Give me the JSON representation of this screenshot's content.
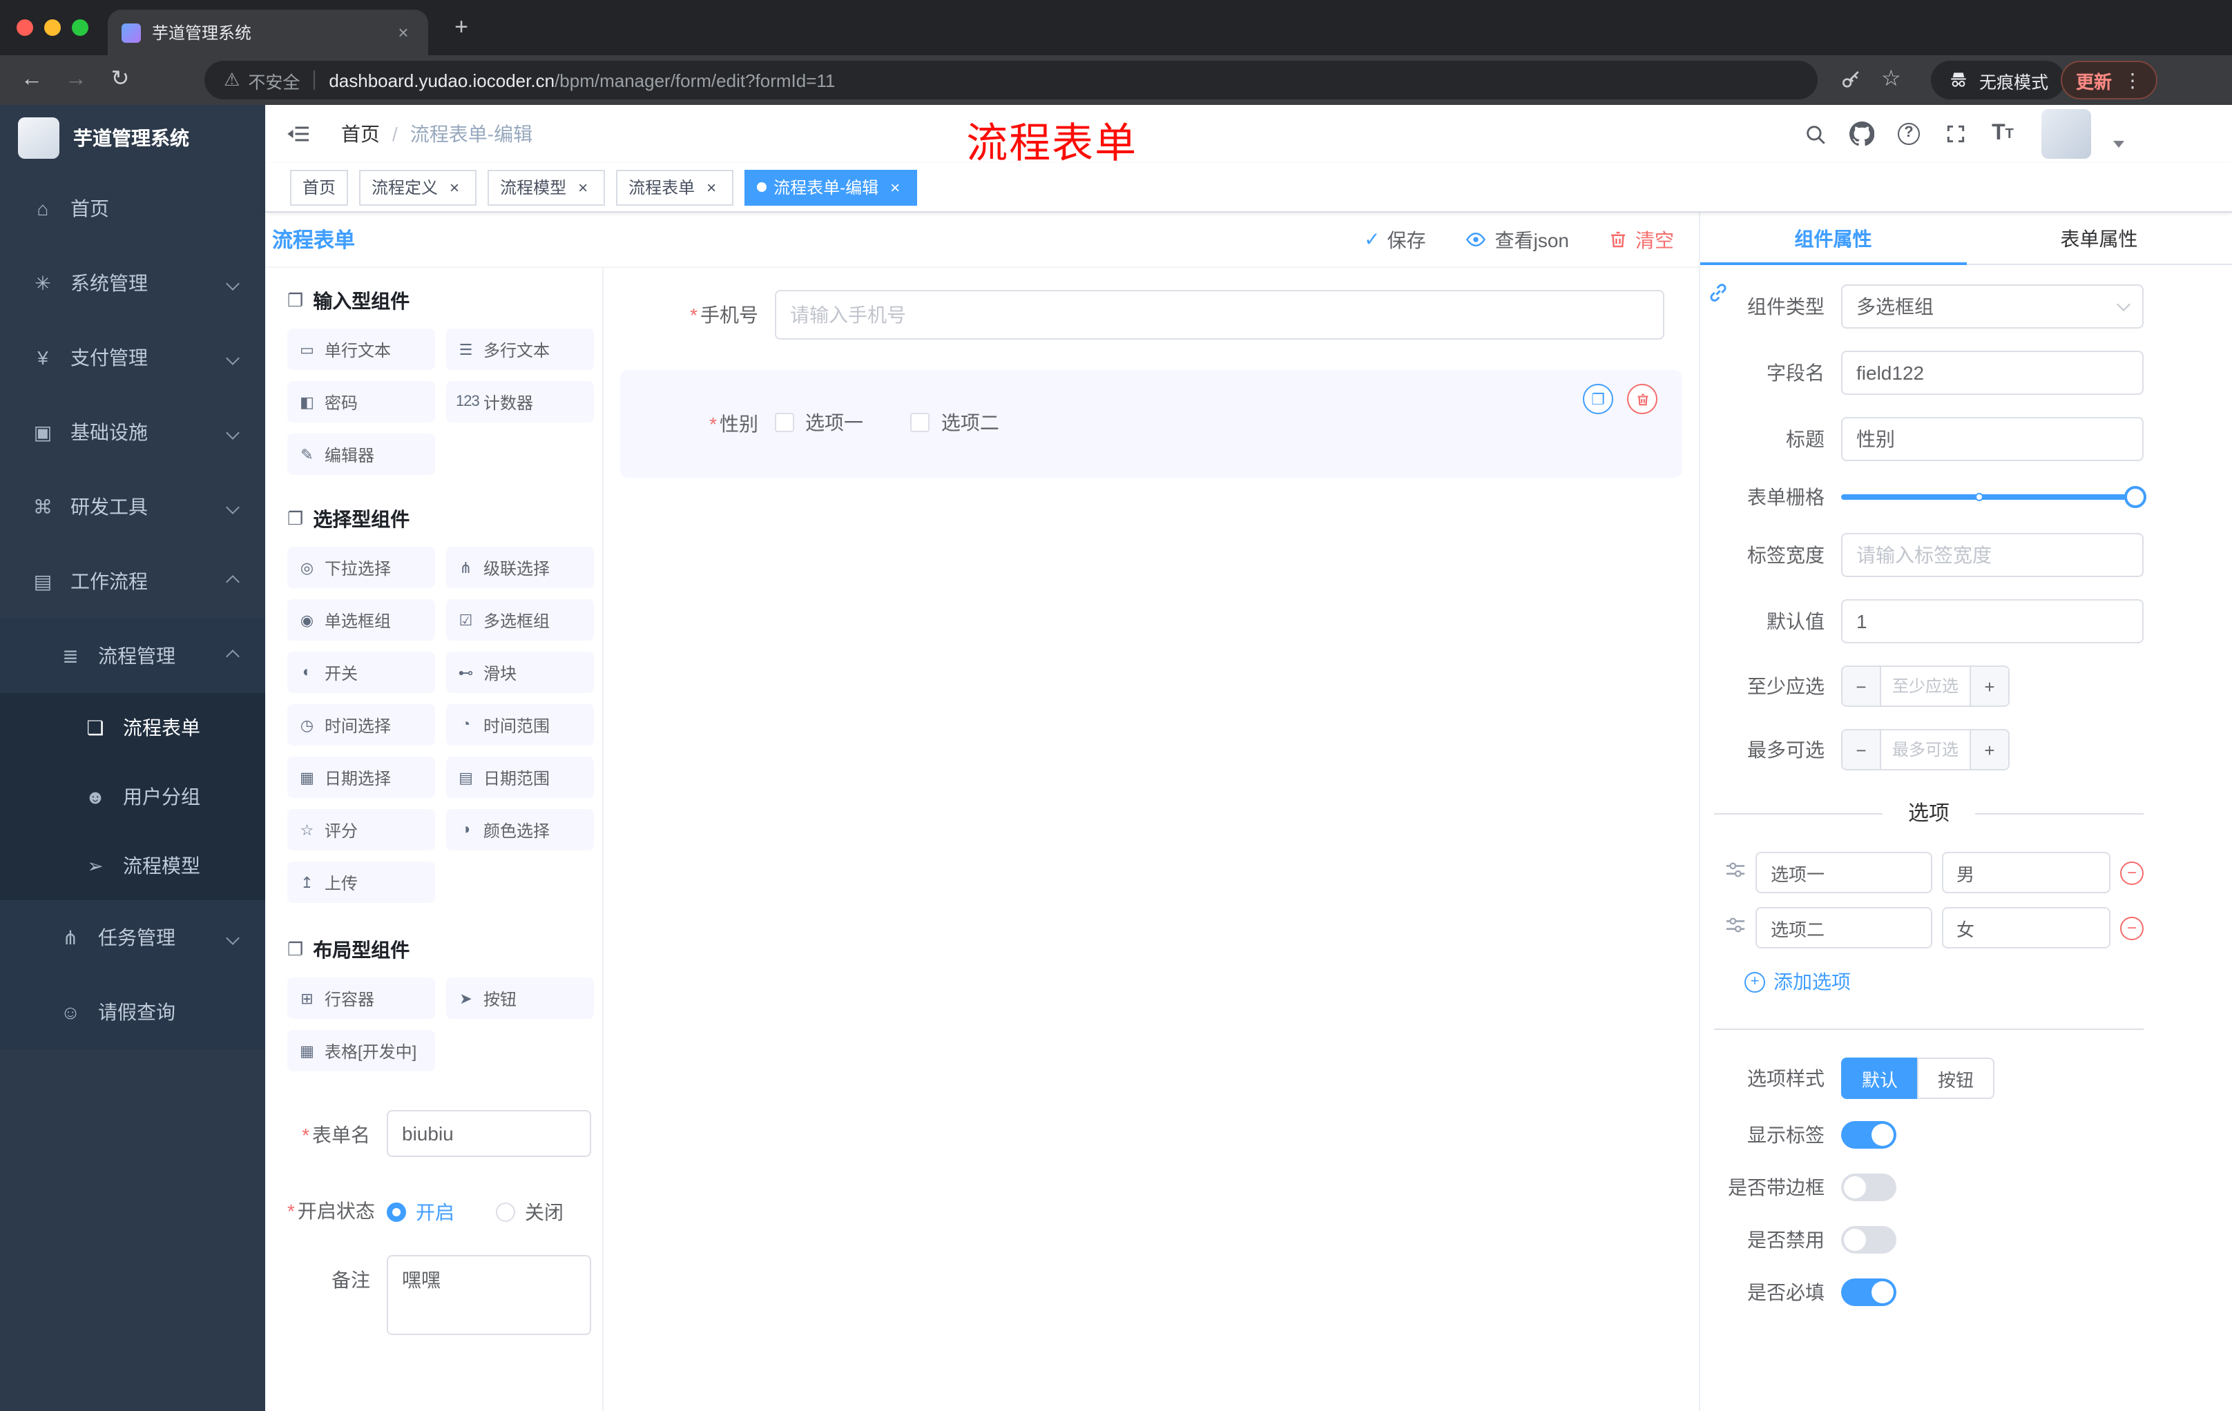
{
  "browser": {
    "tab_title": "芋道管理系统",
    "security_label": "不安全",
    "url_host": "dashboard.yudao.iocoder.cn",
    "url_path": "/bpm/manager/form/edit?formId=11",
    "incognito_label": "无痕模式",
    "update_label": "更新"
  },
  "icons": {
    "back": "←",
    "forward": "→",
    "reload": "↻",
    "warning": "⚠",
    "star": "☆",
    "new_tab": "+",
    "close": "×",
    "more": "⋮",
    "copy": "❐",
    "group": "❐",
    "minus": "−",
    "plus": "+",
    "check": "✓"
  },
  "sidebar": {
    "app_title": "芋道管理系统",
    "items": [
      {
        "icon": "⌂",
        "label": "首页"
      },
      {
        "icon": "✳",
        "label": "系统管理"
      },
      {
        "icon": "¥",
        "label": "支付管理"
      },
      {
        "icon": "▣",
        "label": "基础设施"
      },
      {
        "icon": "⌘",
        "label": "研发工具"
      },
      {
        "icon": "▤",
        "label": "工作流程"
      },
      {
        "icon": "≣",
        "label": "流程管理"
      },
      {
        "icon": "❏",
        "label": "流程表单"
      },
      {
        "icon": "☻",
        "label": "用户分组"
      },
      {
        "icon": "➢",
        "label": "流程模型"
      },
      {
        "icon": "⋔",
        "label": "任务管理"
      },
      {
        "icon": "☺",
        "label": "请假查询"
      }
    ]
  },
  "header": {
    "breadcrumb_home": "首页",
    "breadcrumb_sep": "/",
    "breadcrumb_current": "流程表单-编辑",
    "annotation": "流程表单"
  },
  "tags": {
    "items": [
      {
        "label": "首页"
      },
      {
        "label": "流程定义"
      },
      {
        "label": "流程模型"
      },
      {
        "label": "流程表单"
      },
      {
        "label": "流程表单-编辑"
      }
    ]
  },
  "designer": {
    "title": "流程表单",
    "toolbar": {
      "save": "保存",
      "view_json": "查看json",
      "clear": "清空"
    },
    "groups": [
      {
        "title": "输入型组件",
        "items": [
          {
            "icon": "▭",
            "label": "单行文本"
          },
          {
            "icon": "☰",
            "label": "多行文本"
          },
          {
            "icon": "◧",
            "label": "密码"
          },
          {
            "icon": "123",
            "label": "计数器"
          },
          {
            "icon": "✎",
            "label": "编辑器"
          }
        ]
      },
      {
        "title": "选择型组件",
        "items": [
          {
            "icon": "◎",
            "label": "下拉选择"
          },
          {
            "icon": "⋔",
            "label": "级联选择"
          },
          {
            "icon": "◉",
            "label": "单选框组"
          },
          {
            "icon": "☑",
            "label": "多选框组"
          },
          {
            "icon": "◐",
            "label": "开关"
          },
          {
            "icon": "⊷",
            "label": "滑块"
          },
          {
            "icon": "◷",
            "label": "时间选择"
          },
          {
            "icon": "◔",
            "label": "时间范围"
          },
          {
            "icon": "▦",
            "label": "日期选择"
          },
          {
            "icon": "▤",
            "label": "日期范围"
          },
          {
            "icon": "☆",
            "label": "评分"
          },
          {
            "icon": "◑",
            "label": "颜色选择"
          },
          {
            "icon": "↥",
            "label": "上传"
          }
        ]
      },
      {
        "title": "布局型组件",
        "items": [
          {
            "icon": "⊞",
            "label": "行容器"
          },
          {
            "icon": "➤",
            "label": "按钮"
          },
          {
            "icon": "▦",
            "label": "表格[开发中]"
          }
        ]
      }
    ],
    "form_meta": {
      "name_label": "表单名",
      "name_value": "biubiu",
      "status_label": "开启状态",
      "status_on": "开启",
      "status_off": "关闭",
      "remark_label": "备注",
      "remark_value": "嘿嘿"
    },
    "canvas": {
      "phone_label": "手机号",
      "phone_placeholder": "请输入手机号",
      "gender_label": "性别",
      "gender_opt1": "选项一",
      "gender_opt2": "选项二"
    }
  },
  "props": {
    "tab_component": "组件属性",
    "tab_form": "表单属性",
    "component_type_label": "组件类型",
    "component_type_value": "多选框组",
    "field_name_label": "字段名",
    "field_name_value": "field122",
    "title_label": "标题",
    "title_value": "性别",
    "grid_label": "表单栅格",
    "label_width_label": "标签宽度",
    "label_width_placeholder": "请输入标签宽度",
    "default_label": "默认值",
    "default_value": "1",
    "min_label": "至少应选",
    "min_placeholder": "至少应选",
    "max_label": "最多可选",
    "max_placeholder": "最多可选",
    "options_title": "选项",
    "options": [
      {
        "label": "选项一",
        "value": "男"
      },
      {
        "label": "选项二",
        "value": "女"
      }
    ],
    "add_option": "添加选项",
    "style_label": "选项样式",
    "style_default": "默认",
    "style_button": "按钮",
    "show_label": "显示标签",
    "border_label": "是否带边框",
    "disabled_label": "是否禁用",
    "required_label": "是否必填"
  },
  "colors": {
    "accent": "#409eff",
    "danger": "#f56c6c"
  }
}
